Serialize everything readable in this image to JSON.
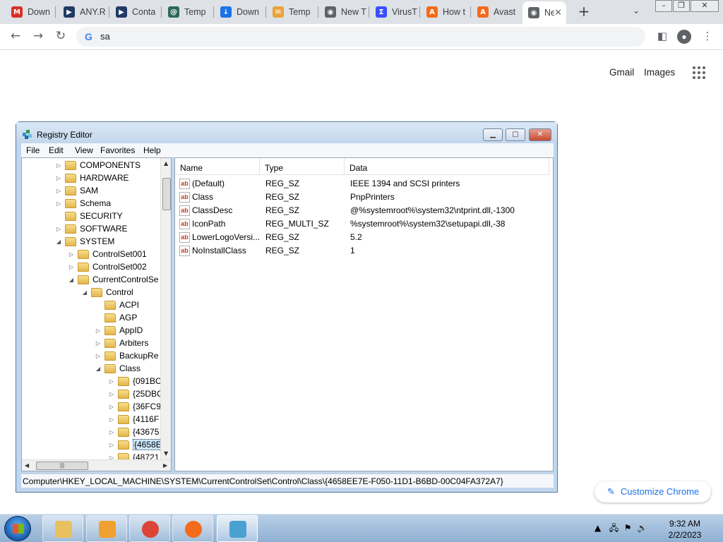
{
  "browser": {
    "tabs": [
      {
        "title": "Down",
        "icon": "gmail-icon",
        "color": "#d93025"
      },
      {
        "title": "ANY.R",
        "icon": "anyrun-icon",
        "color": "#1f3a64"
      },
      {
        "title": "Conta",
        "icon": "anyrun-icon",
        "color": "#1f3a64"
      },
      {
        "title": "Temp",
        "icon": "tempmail-icon",
        "color": "#2d6a5a"
      },
      {
        "title": "Down",
        "icon": "download-icon",
        "color": "#1a73e8"
      },
      {
        "title": "Temp",
        "icon": "mail-icon",
        "color": "#e8a33a"
      },
      {
        "title": "New T",
        "icon": "chrome-icon",
        "color": "#5f6368"
      },
      {
        "title": "VirusT",
        "icon": "virustotal-icon",
        "color": "#394eff"
      },
      {
        "title": "How t",
        "icon": "avast-icon",
        "color": "#f26c1b"
      },
      {
        "title": "Avast",
        "icon": "avast-icon",
        "color": "#f26c1b"
      },
      {
        "title": "Ne",
        "icon": "chrome-icon",
        "color": "#5f6368"
      }
    ],
    "new_tab": "+",
    "omnibox_text": "sa",
    "links": {
      "gmail": "Gmail",
      "images": "Images"
    },
    "customize": "Customize Chrome"
  },
  "regedit": {
    "title": "Registry Editor",
    "menu": [
      "File",
      "Edit",
      "View",
      "Favorites",
      "Help"
    ],
    "tree": [
      {
        "label": "COMPONENTS",
        "expander": "▷"
      },
      {
        "label": "HARDWARE",
        "expander": "▷"
      },
      {
        "label": "SAM",
        "expander": "▷"
      },
      {
        "label": "Schema",
        "expander": "▷"
      },
      {
        "label": "SECURITY",
        "expander": ""
      },
      {
        "label": "SOFTWARE",
        "expander": "▷"
      },
      {
        "label": "SYSTEM",
        "expander": "◢"
      },
      {
        "label": "ControlSet001",
        "expander": "▷"
      },
      {
        "label": "ControlSet002",
        "expander": "▷"
      },
      {
        "label": "CurrentControlSe",
        "expander": "◢"
      },
      {
        "label": "Control",
        "expander": "◢"
      },
      {
        "label": "ACPI",
        "expander": ""
      },
      {
        "label": "AGP",
        "expander": ""
      },
      {
        "label": "AppID",
        "expander": "▷"
      },
      {
        "label": "Arbiters",
        "expander": "▷"
      },
      {
        "label": "BackupRe",
        "expander": "▷"
      },
      {
        "label": "Class",
        "expander": "◢"
      },
      {
        "label": "{091BC",
        "expander": "▷"
      },
      {
        "label": "{25DBC",
        "expander": "▷"
      },
      {
        "label": "{36FC9",
        "expander": "▷"
      },
      {
        "label": "{4116F",
        "expander": "▷"
      },
      {
        "label": "{43675",
        "expander": "▷"
      },
      {
        "label": "{4658E",
        "expander": "▷"
      },
      {
        "label": "{48721",
        "expander": "▷"
      }
    ],
    "columns": [
      "Name",
      "Type",
      "Data"
    ],
    "values": [
      {
        "name": "(Default)",
        "type": "REG_SZ",
        "data": "IEEE 1394 and SCSI printers"
      },
      {
        "name": "Class",
        "type": "REG_SZ",
        "data": "PnpPrinters"
      },
      {
        "name": "ClassDesc",
        "type": "REG_SZ",
        "data": "@%systemroot%\\system32\\ntprint.dll,-1300"
      },
      {
        "name": "IconPath",
        "type": "REG_MULTI_SZ",
        "data": "%systemroot%\\system32\\setupapi.dll,-38"
      },
      {
        "name": "LowerLogoVersi...",
        "type": "REG_SZ",
        "data": "5.2"
      },
      {
        "name": "NoInstallClass",
        "type": "REG_SZ",
        "data": "1"
      }
    ],
    "status": "Computer\\HKEY_LOCAL_MACHINE\\SYSTEM\\CurrentControlSet\\Control\\Class\\{4658EE7E-F050-11D1-B6BD-00C04FA372A7}"
  },
  "taskbar": {
    "apps": [
      {
        "name": "explorer",
        "color": "#e8c060"
      },
      {
        "name": "media-player",
        "color": "#f0a030"
      },
      {
        "name": "chrome",
        "color": "#db4437"
      },
      {
        "name": "avast",
        "color": "#f26c1b"
      },
      {
        "name": "regedit",
        "color": "#4aa0d0"
      }
    ],
    "time": "9:32 AM",
    "date": "2/2/2023"
  }
}
